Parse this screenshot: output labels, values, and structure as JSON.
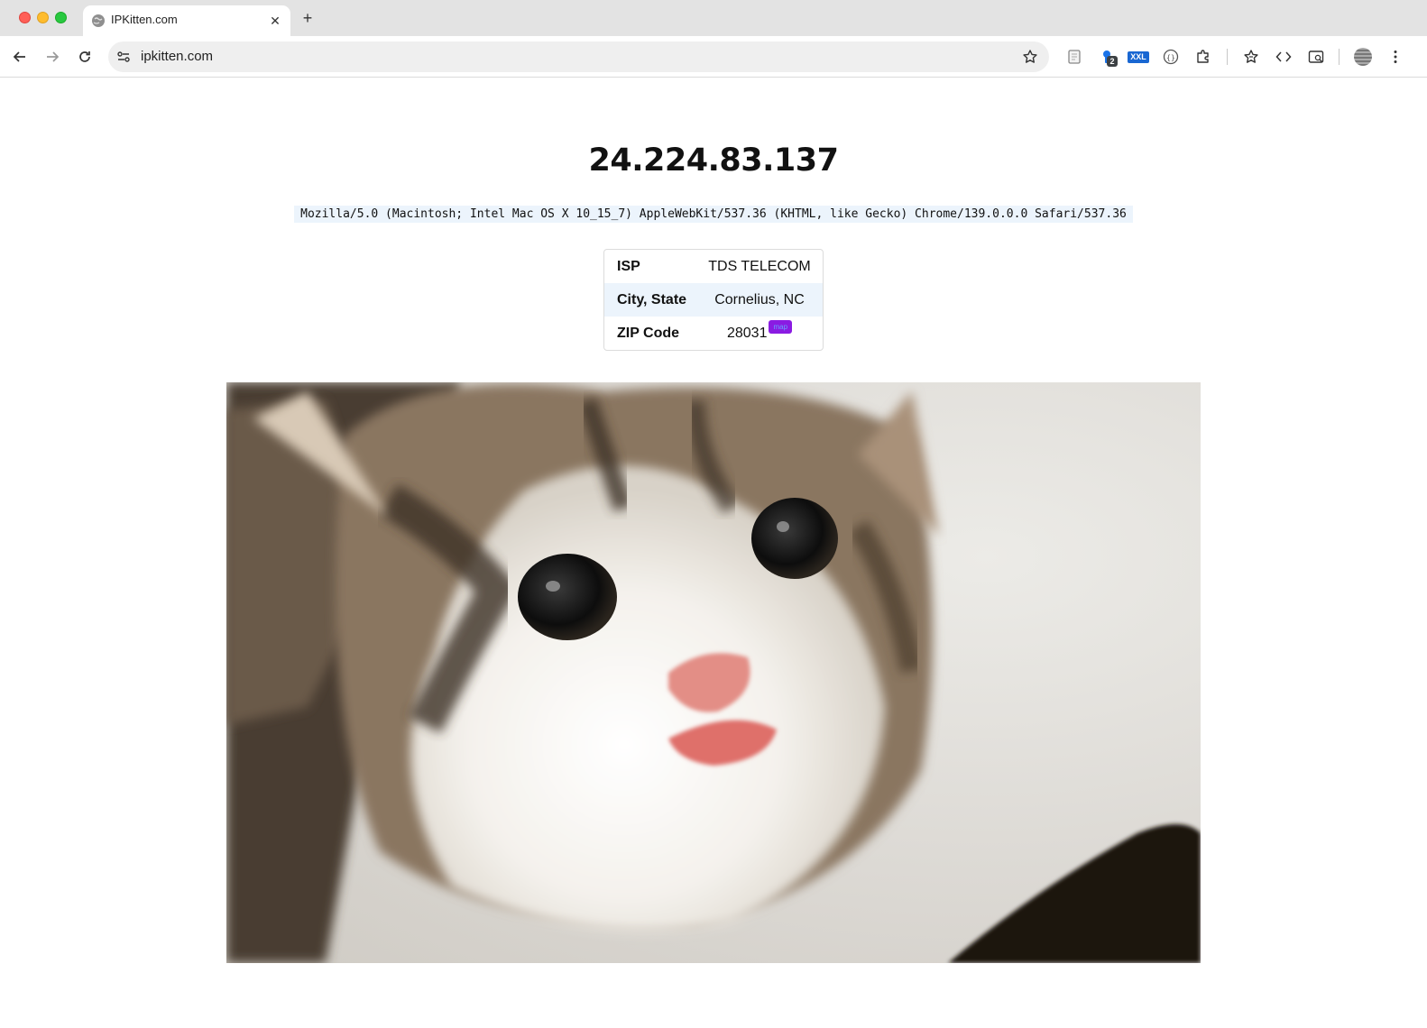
{
  "browser": {
    "tab": {
      "title": "IPKitten.com",
      "favicon": "globe-icon"
    },
    "omnibox": {
      "url": "ipkitten.com"
    },
    "extensions": {
      "badge_count": "2",
      "xxl_label": "XXL"
    }
  },
  "page": {
    "ip_address": "24.224.83.137",
    "user_agent": "Mozilla/5.0 (Macintosh; Intel Mac OS X 10_15_7) AppleWebKit/537.36 (KHTML, like Gecko) Chrome/139.0.0.0 Safari/537.36",
    "info_rows": [
      {
        "label": "ISP",
        "value": "TDS TELECOM"
      },
      {
        "label": "City, State",
        "value": "Cornelius, NC"
      },
      {
        "label": "ZIP Code",
        "value": "28031"
      }
    ],
    "map_link_label": "map",
    "image": {
      "subject": "kitten-photo"
    }
  },
  "colors": {
    "ua_background": "#ecf4fc",
    "map_badge": "#8a1be2",
    "accent_blue": "#1967d2"
  }
}
